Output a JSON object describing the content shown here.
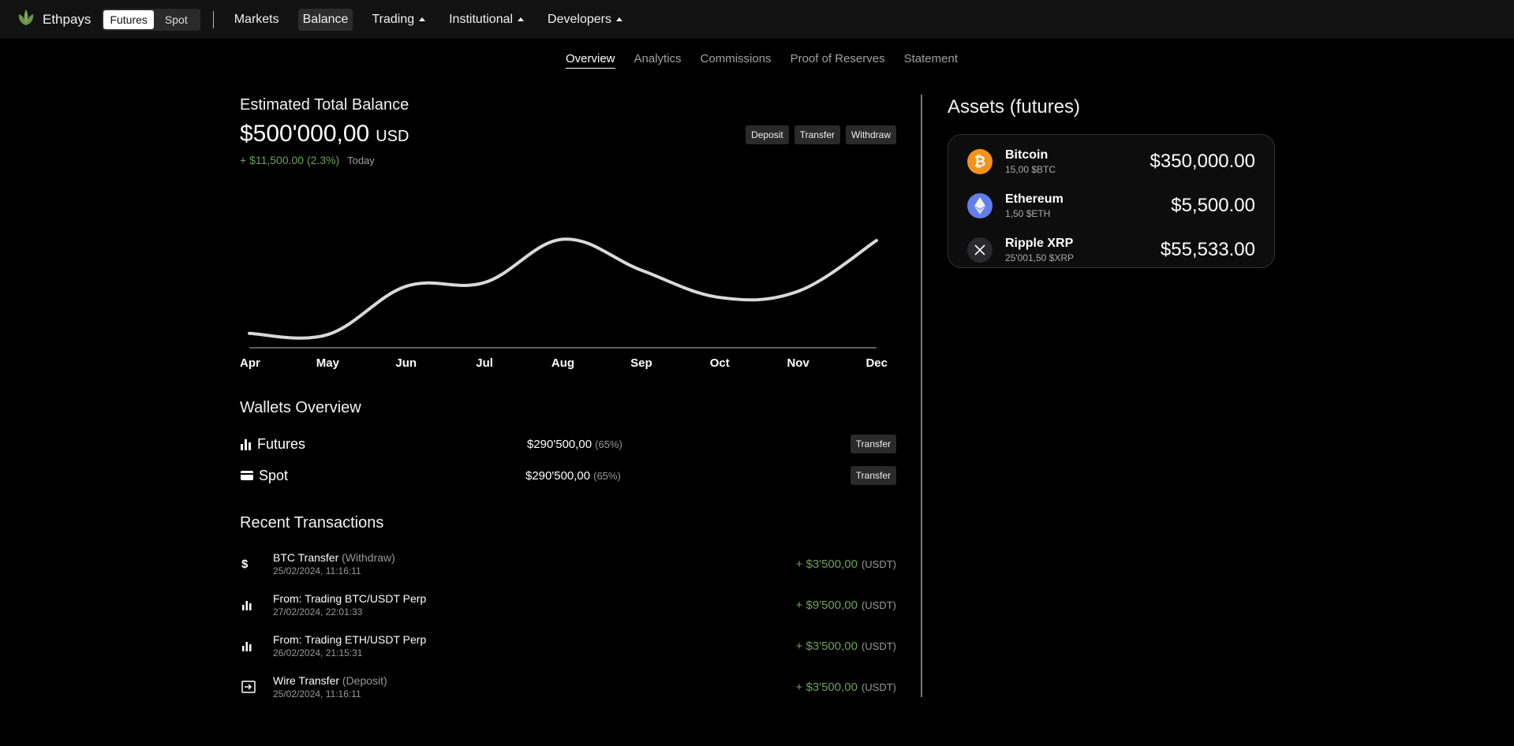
{
  "nav": {
    "brand": "Ethpays",
    "mode_tabs": [
      "Futures",
      "Spot"
    ],
    "items": [
      {
        "label": "Markets",
        "has_caret": false
      },
      {
        "label": "Balance",
        "has_caret": false
      },
      {
        "label": "Trading",
        "has_caret": true
      },
      {
        "label": "Institutional",
        "has_caret": true
      },
      {
        "label": "Developers",
        "has_caret": true
      }
    ]
  },
  "subtabs": [
    "Overview",
    "Analytics",
    "Commissions",
    "Proof of Reserves",
    "Statement"
  ],
  "balance": {
    "title": "Estimated Total Balance",
    "value": "$500'000,00",
    "currency": "USD",
    "change": "+ $11,500.00 (2.3%)",
    "period": "Today",
    "actions": [
      "Deposit",
      "Transfer",
      "Withdraw"
    ]
  },
  "chart_data": {
    "type": "line",
    "categories": [
      "Apr",
      "May",
      "Jun",
      "Jul",
      "Aug",
      "Sep",
      "Oct",
      "Nov",
      "Dec"
    ],
    "values": [
      4,
      3,
      42,
      45,
      80,
      55,
      33,
      38,
      79
    ],
    "ylim": [
      0,
      100
    ],
    "grid": false,
    "xlabel": "",
    "ylabel": ""
  },
  "wallets": {
    "title": "Wallets Overview",
    "items": [
      {
        "name": "Futures",
        "icon": "bar-chart-icon",
        "amount": "$290'500,00",
        "pct": "(65%)",
        "action": "Transfer"
      },
      {
        "name": "Spot",
        "icon": "wallet-icon",
        "amount": "$290'500,00",
        "pct": "(65%)",
        "action": "Transfer"
      }
    ]
  },
  "transactions": {
    "title": "Recent Transactions",
    "items": [
      {
        "icon": "dollar-icon",
        "title": "BTC Transfer",
        "note": "(Withdraw)",
        "date": "25/02/2024, 11:16:11",
        "amount": "+ $3'500,00",
        "cur": "(USDT)"
      },
      {
        "icon": "bar-chart-icon",
        "title": "From: Trading BTC/USDT Perp",
        "note": "",
        "date": "27/02/2024, 22:01:33",
        "amount": "+ $9'500,00",
        "cur": "(USDT)"
      },
      {
        "icon": "bar-chart-icon",
        "title": "From: Trading ETH/USDT Perp",
        "note": "",
        "date": "26/02/2024, 21:15:31",
        "amount": "+ $3'500,00",
        "cur": "(USDT)"
      },
      {
        "icon": "deposit-icon",
        "title": "Wire Transfer",
        "note": "(Deposit)",
        "date": "25/02/2024, 11:16:11",
        "amount": "+ $3'500,00",
        "cur": "(USDT)"
      }
    ]
  },
  "assets": {
    "title": "Assets (futures)",
    "items": [
      {
        "name": "Bitcoin",
        "sub": "15,00 $BTC",
        "value": "$350,000.00",
        "icon": "bitcoin-icon",
        "color": "#f7931a"
      },
      {
        "name": "Ethereum",
        "sub": "1,50 $ETH",
        "value": "$5,500.00",
        "icon": "ethereum-icon",
        "color": "#627eea"
      },
      {
        "name": "Ripple XRP",
        "sub": "25'001,50 $XRP",
        "value": "$55,533.00",
        "icon": "xrp-icon",
        "color": "#2a2a2e"
      }
    ]
  },
  "colors": {
    "positive": "#6fa05a",
    "line": "#d9d9d9"
  }
}
